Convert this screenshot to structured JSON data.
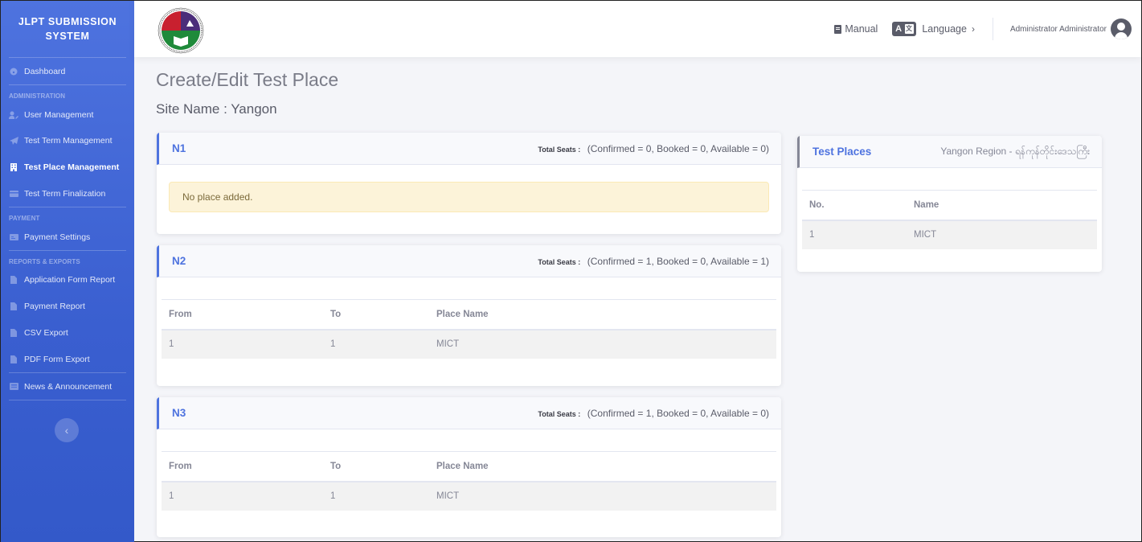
{
  "app": {
    "title": "JLPT SUBMISSION SYSTEM",
    "title_line1": "JLPT SUBMISSION",
    "title_line2": "SYSTEM"
  },
  "sidebar": {
    "dashboard": {
      "label": "Dashboard",
      "icon": "tachometer-icon"
    },
    "sections": [
      {
        "heading": "ADMINISTRATION",
        "items": [
          {
            "label": "User Management",
            "icon": "user-edit-icon"
          },
          {
            "label": "Test Term Management",
            "icon": "paper-plane-icon"
          },
          {
            "label": "Test Place Management",
            "icon": "building-icon",
            "active": true
          },
          {
            "label": "Test Term Finalization",
            "icon": "credit-card-icon"
          }
        ]
      },
      {
        "heading": "PAYMENT",
        "items": [
          {
            "label": "Payment Settings",
            "icon": "money-card-icon"
          }
        ]
      },
      {
        "heading": "REPORTS & EXPORTS",
        "items": [
          {
            "label": "Application Form Report",
            "icon": "file-icon"
          },
          {
            "label": "Payment Report",
            "icon": "file-invoice-icon"
          },
          {
            "label": "CSV Export",
            "icon": "file-csv-icon"
          },
          {
            "label": "PDF Form Export",
            "icon": "file-pdf-icon"
          }
        ]
      }
    ],
    "news": {
      "label": "News & Announcement",
      "icon": "newspaper-icon"
    },
    "toggle_icon": "chevron-left-icon"
  },
  "topbar": {
    "manual_label": "Manual",
    "language_label": "Language",
    "language_icon_left": "A",
    "language_icon_right": "文",
    "user_name": "Administrator Administrator"
  },
  "main": {
    "page_title": "Create/Edit Test Place",
    "site_name": "Site Name : Yangon"
  },
  "levels": [
    {
      "title": "N1",
      "seats_label": "Total Seats :",
      "seats_detail": "(Confirmed = 0, Booked = 0, Available = 0)",
      "empty_message": "No place added.",
      "columns": [],
      "rows": []
    },
    {
      "title": "N2",
      "seats_label": "Total Seats :",
      "seats_detail": "(Confirmed = 1, Booked = 0, Available = 1)",
      "columns": [
        "From",
        "To",
        "Place Name"
      ],
      "rows": [
        [
          "1",
          "1",
          "MICT"
        ]
      ]
    },
    {
      "title": "N3",
      "seats_label": "Total Seats :",
      "seats_detail": "(Confirmed = 1, Booked = 0, Available = 0)",
      "columns": [
        "From",
        "To",
        "Place Name"
      ],
      "rows": [
        [
          "1",
          "1",
          "MICT"
        ]
      ]
    }
  ],
  "test_places": {
    "title": "Test Places",
    "region": "Yangon Region - ရန်ကုန်တိုင်းဒေသကြီး",
    "columns": [
      "No.",
      "Name"
    ],
    "rows": [
      [
        "1",
        "MICT"
      ]
    ]
  },
  "colors": {
    "primary": "#4e73df",
    "sidebar_bottom": "#3359c9",
    "text_muted": "#858796",
    "alert_bg": "#fcf3d9"
  }
}
